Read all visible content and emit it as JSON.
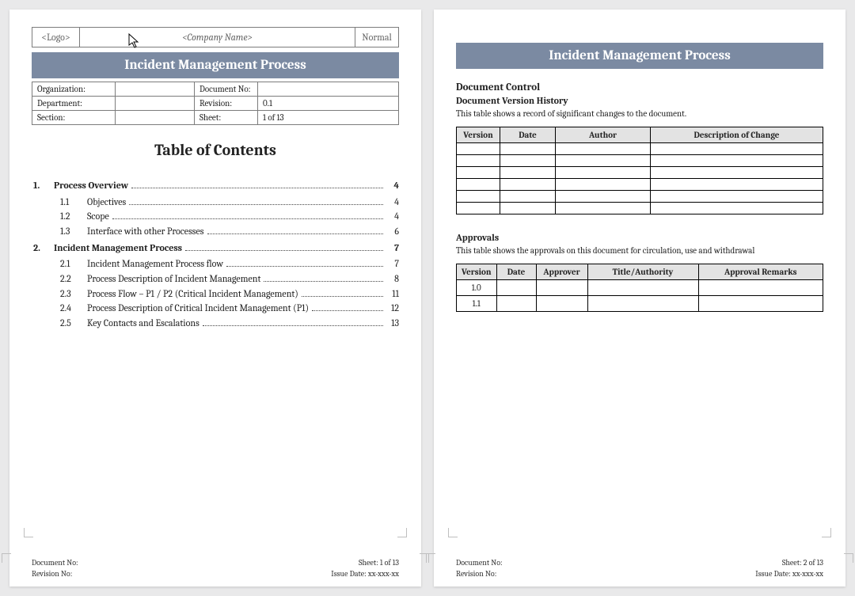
{
  "header": {
    "logo": "<Logo>",
    "company": "<Company Name>",
    "normal": "Normal",
    "title": "Incident Management Process",
    "meta": {
      "org_label": "Organization:",
      "org_val": "",
      "docno_label": "Document No:",
      "docno_val": "",
      "dept_label": "Department:",
      "dept_val": "",
      "rev_label": "Revision:",
      "rev_val": "0.1",
      "sect_label": "Section:",
      "sect_val": "",
      "sheet_label": "Sheet:",
      "sheet_val": "1 of 13"
    }
  },
  "page1": {
    "toc_title": "Table of Contents",
    "toc": [
      {
        "level": 1,
        "num": "1.",
        "label": "Process Overview",
        "page": "4"
      },
      {
        "level": 2,
        "num": "1.1",
        "label": "Objectives",
        "page": "4"
      },
      {
        "level": 2,
        "num": "1.2",
        "label": "Scope",
        "page": "4"
      },
      {
        "level": 2,
        "num": "1.3",
        "label": "Interface with other Processes",
        "page": "6"
      },
      {
        "level": 1,
        "num": "2.",
        "label": "Incident Management Process",
        "page": "7"
      },
      {
        "level": 2,
        "num": "2.1",
        "label": "Incident Management Process flow",
        "page": "7"
      },
      {
        "level": 2,
        "num": "2.2",
        "label": "Process Description of Incident Management",
        "page": "8"
      },
      {
        "level": 2,
        "num": "2.3",
        "label": "Process Flow – P1 / P2 (Critical Incident Management)",
        "page": "11"
      },
      {
        "level": 2,
        "num": "2.4",
        "label": "Process Description of Critical Incident Management (P1)",
        "page": "12"
      },
      {
        "level": 2,
        "num": "2.5",
        "label": "Key Contacts and Escalations",
        "page": "13"
      }
    ],
    "footer": {
      "docno": "Document No:",
      "sheet": "Sheet: 1 of 13",
      "revno": "Revision No:",
      "issue": "Issue Date: xx-xxx-xx"
    }
  },
  "page2": {
    "title": "Incident Management Process",
    "dc": "Document Control",
    "dvh": {
      "heading": "Document Version History",
      "caption": "This table shows a record of significant changes to the document.",
      "cols": [
        "Version",
        "Date",
        "Author",
        "Description of Change"
      ],
      "rows": [
        [
          "",
          "",
          "",
          ""
        ],
        [
          "",
          "",
          "",
          ""
        ],
        [
          "",
          "",
          "",
          ""
        ],
        [
          "",
          "",
          "",
          ""
        ],
        [
          "",
          "",
          "",
          ""
        ],
        [
          "",
          "",
          "",
          ""
        ]
      ]
    },
    "appr": {
      "heading": "Approvals",
      "caption": "This table shows the approvals on this document for circulation, use and withdrawal",
      "cols": [
        "Version",
        "Date",
        "Approver",
        "Title/Authority",
        "Approval Remarks"
      ],
      "rows": [
        [
          "1.0",
          "",
          "",
          "",
          ""
        ],
        [
          "1.1",
          "",
          "",
          "",
          ""
        ]
      ]
    },
    "footer": {
      "docno": "Document No:",
      "sheet": "Sheet: 2 of 13",
      "revno": "Revision No:",
      "issue": "Issue Date: xx-xxx-xx"
    }
  }
}
